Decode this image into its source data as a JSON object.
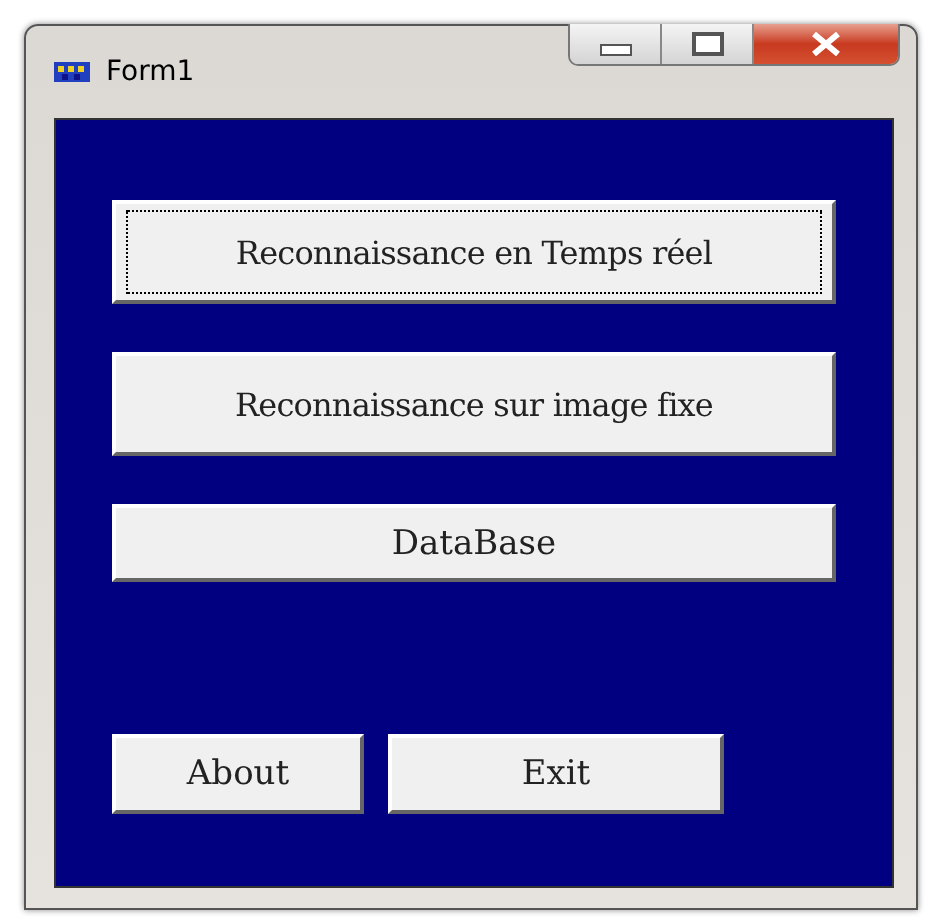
{
  "window": {
    "title": "Form1"
  },
  "title_buttons": [
    {
      "kind": "minimize"
    },
    {
      "kind": "maximize"
    },
    {
      "kind": "close"
    }
  ],
  "buttons": [
    {
      "label": "Reconnaissance en Temps réel",
      "focused": true,
      "kind": "tall"
    },
    {
      "label": "Reconnaissance sur image fixe",
      "focused": false,
      "kind": "tall"
    },
    {
      "label": "DataBase",
      "focused": false,
      "kind": "short"
    }
  ],
  "bottom_buttons": [
    {
      "label": "About",
      "focused": false
    },
    {
      "label": "Exit",
      "focused": false
    }
  ]
}
